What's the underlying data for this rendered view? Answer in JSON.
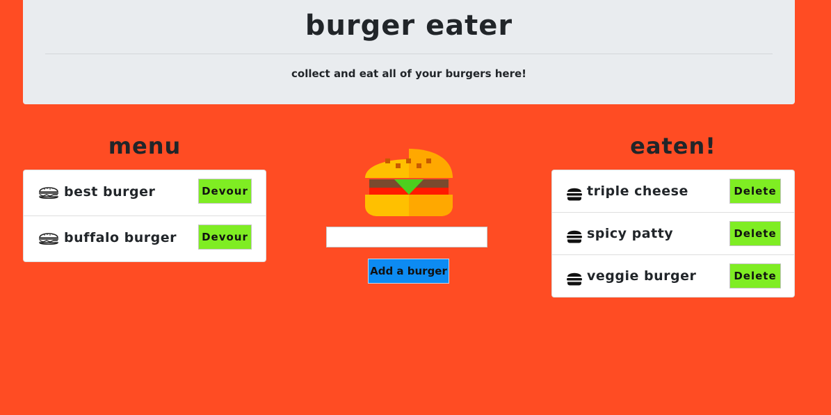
{
  "header": {
    "title": "burger eater",
    "tagline": "collect and eat all of your burgers here!"
  },
  "menu": {
    "heading": "menu",
    "items": [
      {
        "name": "best burger",
        "button": "Devour",
        "icon": "burger-outline-icon"
      },
      {
        "name": "buffalo burger",
        "button": "Devour",
        "icon": "burger-outline-icon"
      }
    ]
  },
  "center": {
    "image": "hamburger-icon",
    "input_value": "",
    "input_placeholder": "",
    "add_button": "Add a burger"
  },
  "eaten": {
    "heading": "eaten!",
    "items": [
      {
        "name": "triple cheese",
        "button": "Delete",
        "icon": "eaten-burger-icon"
      },
      {
        "name": "spicy patty",
        "button": "Delete",
        "icon": "eaten-burger-icon"
      },
      {
        "name": "veggie burger",
        "button": "Delete",
        "icon": "eaten-burger-icon"
      }
    ]
  },
  "colors": {
    "background": "#ff4c23",
    "jumbotron": "#e9ecef",
    "devour_button": "#7fed23",
    "add_button": "#0d8bf2"
  }
}
